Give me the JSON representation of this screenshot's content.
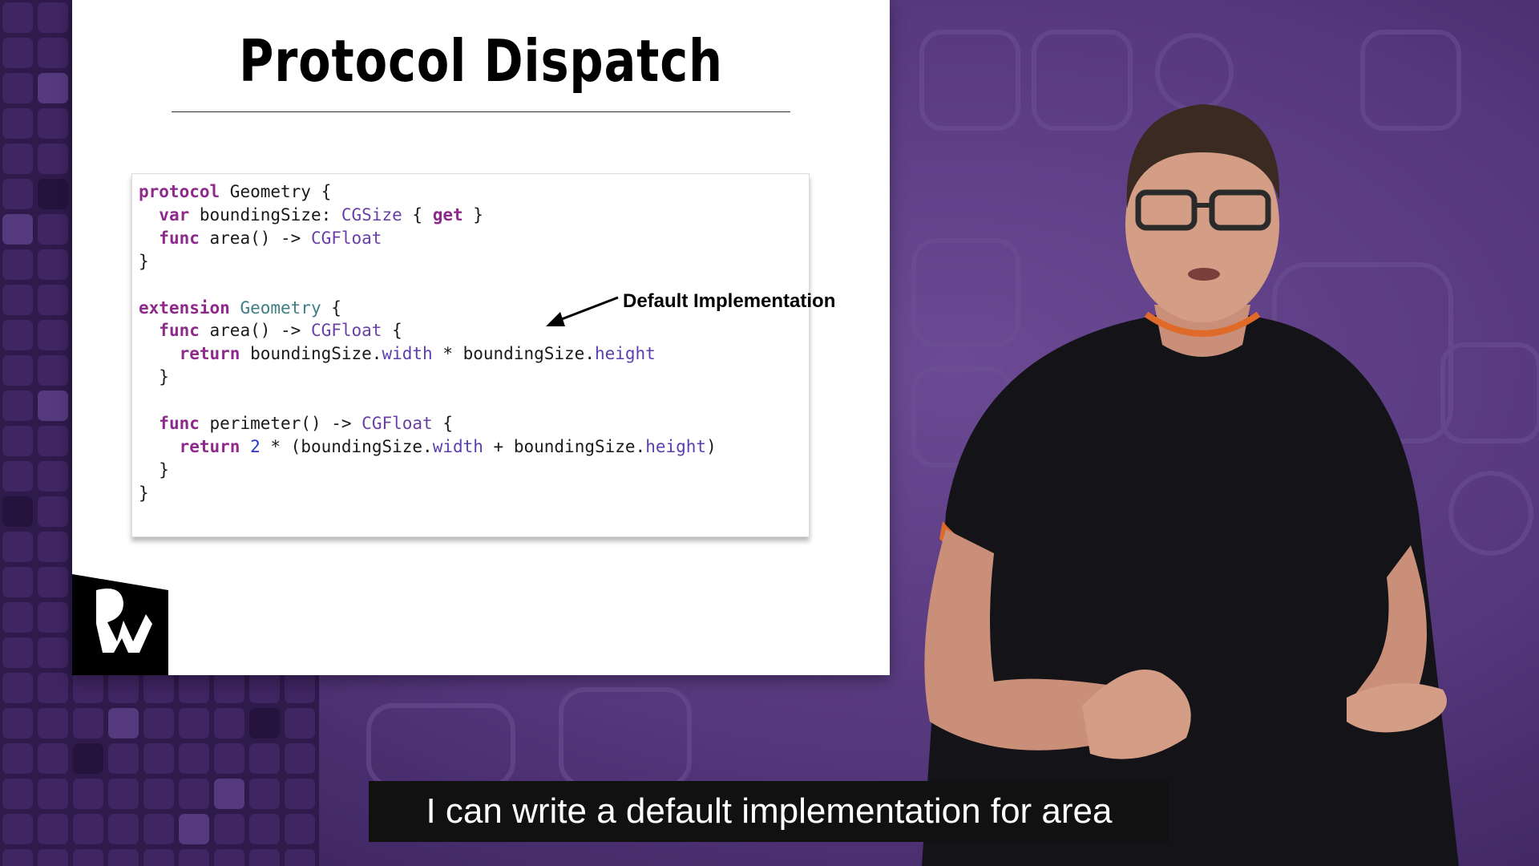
{
  "slide": {
    "title": "Protocol Dispatch",
    "code_lines": [
      [
        {
          "t": "protocol",
          "c": "kw"
        },
        {
          "t": " Geometry {"
        }
      ],
      [
        {
          "t": "  "
        },
        {
          "t": "var",
          "c": "kw"
        },
        {
          "t": " boundingSize: "
        },
        {
          "t": "CGSize",
          "c": "ty"
        },
        {
          "t": " { "
        },
        {
          "t": "get",
          "c": "kw"
        },
        {
          "t": " }"
        }
      ],
      [
        {
          "t": "  "
        },
        {
          "t": "func",
          "c": "kw"
        },
        {
          "t": " area() -> "
        },
        {
          "t": "CGFloat",
          "c": "ty"
        }
      ],
      [
        {
          "t": "}"
        }
      ],
      [
        {
          "t": ""
        }
      ],
      [
        {
          "t": "extension",
          "c": "kw"
        },
        {
          "t": " "
        },
        {
          "t": "Geometry",
          "c": "tg"
        },
        {
          "t": " {"
        }
      ],
      [
        {
          "t": "  "
        },
        {
          "t": "func",
          "c": "kw"
        },
        {
          "t": " area() -> "
        },
        {
          "t": "CGFloat",
          "c": "ty"
        },
        {
          "t": " {"
        }
      ],
      [
        {
          "t": "    "
        },
        {
          "t": "return",
          "c": "kw"
        },
        {
          "t": " boundingSize."
        },
        {
          "t": "width",
          "c": "pr"
        },
        {
          "t": " * boundingSize."
        },
        {
          "t": "height",
          "c": "pr"
        }
      ],
      [
        {
          "t": "  }"
        }
      ],
      [
        {
          "t": ""
        }
      ],
      [
        {
          "t": "  "
        },
        {
          "t": "func",
          "c": "kw"
        },
        {
          "t": " perimeter() -> "
        },
        {
          "t": "CGFloat",
          "c": "ty"
        },
        {
          "t": " {"
        }
      ],
      [
        {
          "t": "    "
        },
        {
          "t": "return",
          "c": "kw"
        },
        {
          "t": " "
        },
        {
          "t": "2",
          "c": "nm"
        },
        {
          "t": " * (boundingSize."
        },
        {
          "t": "width",
          "c": "pr"
        },
        {
          "t": " + boundingSize."
        },
        {
          "t": "height",
          "c": "pr"
        },
        {
          "t": ")"
        }
      ],
      [
        {
          "t": "  }"
        }
      ],
      [
        {
          "t": "}"
        }
      ]
    ],
    "annotation": "Default Implementation"
  },
  "caption": "I can write a default implementation for area",
  "icons": [
    "raywenderlich-logo-icon",
    "arrow-icon",
    "presenter-figure"
  ],
  "colors": {
    "background": "#4a2e6e",
    "keyword": "#8e2a8c",
    "type": "#6a3fa6",
    "caption_bg": "#111111"
  }
}
